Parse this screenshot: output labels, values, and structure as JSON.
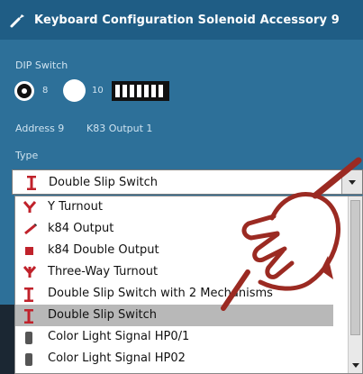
{
  "window": {
    "title": "Keyboard Configuration Solenoid Accessory 9",
    "icon": "wrench-icon"
  },
  "dip_switch": {
    "label": "DIP Switch",
    "options": [
      {
        "label": "8",
        "selected": true
      },
      {
        "label": "10",
        "selected": false
      }
    ],
    "graphic": "dip-switch-icon"
  },
  "address_text": "Address 9",
  "k83_text": "K83 Output 1",
  "type": {
    "label": "Type",
    "selected": "Double Slip Switch",
    "selected_icon": "double-slip-switch-icon"
  },
  "dropdown": {
    "items": [
      {
        "label": "Y Turnout",
        "icon": "y-turnout-icon"
      },
      {
        "label": "k84 Output",
        "icon": "k84-output-icon"
      },
      {
        "label": "k84 Double Output",
        "icon": "k84-double-output-icon"
      },
      {
        "label": "Three-Way Turnout",
        "icon": "three-way-turnout-icon"
      },
      {
        "label": "Double Slip Switch with 2 Mechanisms",
        "icon": "double-slip-switch-icon"
      },
      {
        "label": "Double Slip Switch",
        "icon": "double-slip-switch-icon",
        "selected": true
      },
      {
        "label": "Color Light Signal HP0/1",
        "icon": "signal-icon"
      },
      {
        "label": "Color Light Signal HP02",
        "icon": "signal-icon"
      }
    ]
  },
  "colors": {
    "title_bar": "#1f5d85",
    "panel": "#2d7099",
    "item_icon": "#c0222b",
    "hand_stroke": "#9b2a22"
  }
}
